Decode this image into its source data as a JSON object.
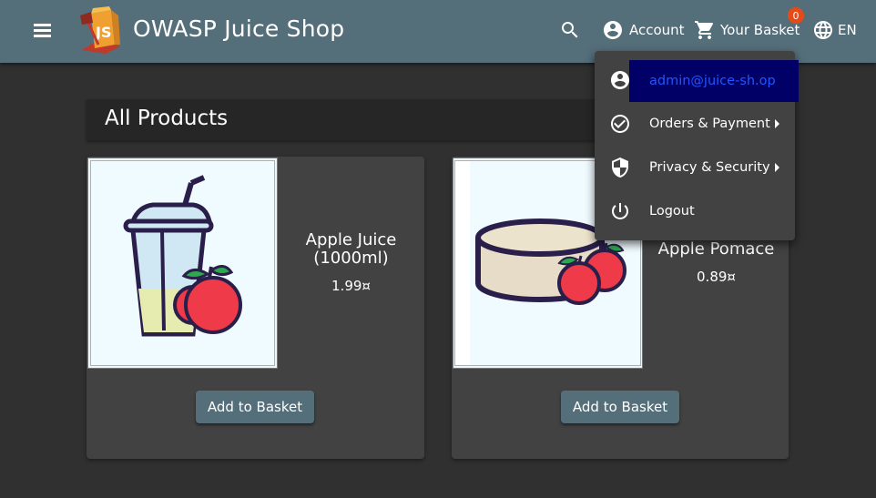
{
  "app": {
    "title": "OWASP Juice Shop"
  },
  "toolbar": {
    "search_icon": "search-icon",
    "account_label": "Account",
    "basket_label": "Your Basket",
    "basket_count": "0",
    "language": "EN"
  },
  "main": {
    "heading": "All Products"
  },
  "products": [
    {
      "name": "Apple Juice (1000ml)",
      "price": "1.99¤",
      "button": "Add to Basket"
    },
    {
      "name": "Apple Pomace",
      "price": "0.89¤",
      "button": "Add to Basket"
    }
  ],
  "account_menu": {
    "email": "admin@juice-sh.op",
    "items": [
      {
        "label": "Orders & Payment",
        "icon": "check-circle-icon",
        "submenu": true
      },
      {
        "label": "Privacy & Security",
        "icon": "shield-icon",
        "submenu": true
      },
      {
        "label": "Logout",
        "icon": "power-icon",
        "submenu": false
      }
    ]
  },
  "colors": {
    "toolbar": "#546e7a",
    "background": "#303030",
    "card": "#424242",
    "badge": "#e64a19"
  }
}
